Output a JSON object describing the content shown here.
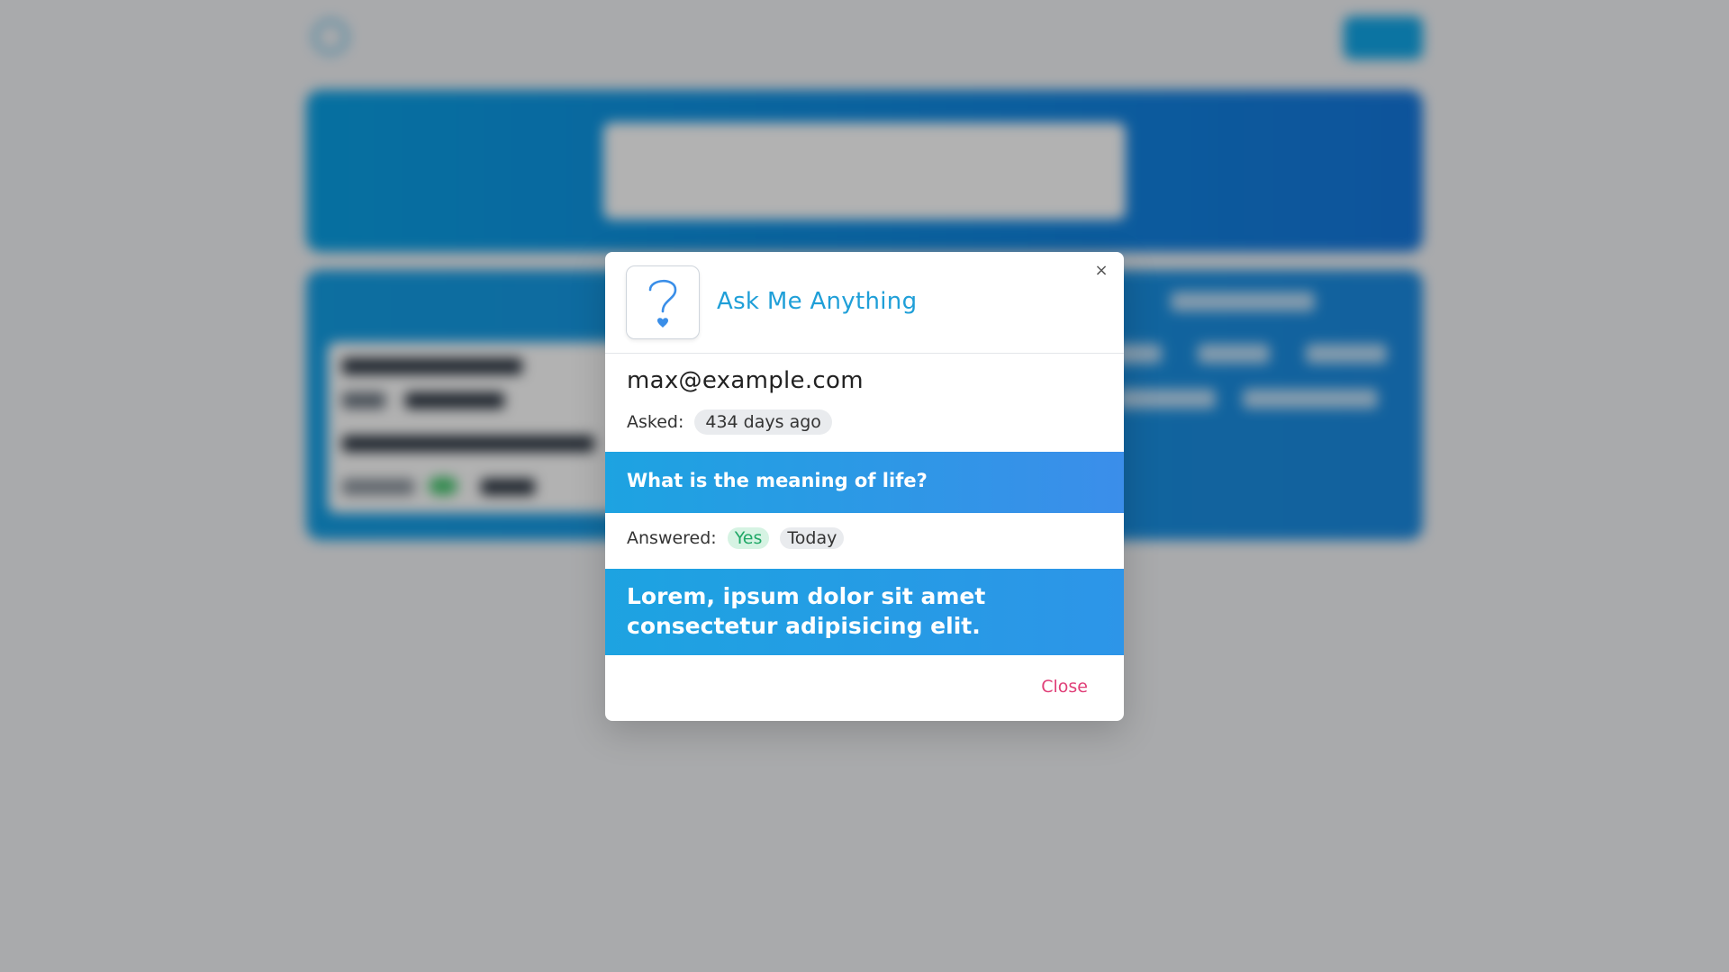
{
  "background": {
    "search_placeholder": ""
  },
  "modal": {
    "title": "Ask Me Anything",
    "close_icon": "×",
    "app_icon": "question-mark-icon",
    "email": "max@example.com",
    "asked_label": "Asked:",
    "asked_value": "434 days ago",
    "question": "What is the meaning of life?",
    "answered_label": "Answered:",
    "answered_status": "Yes",
    "answered_when": "Today",
    "answer": "Lorem, ipsum dolor sit amet consectetur adipisicing elit.",
    "close_label": "Close"
  },
  "colors": {
    "accent": "#1f9fd8",
    "gradient_start": "#1da3e1",
    "gradient_end": "#3b8eea",
    "close_link": "#e03f78",
    "status_yes_bg": "#d6f3e3",
    "status_yes_text": "#1fa866"
  }
}
